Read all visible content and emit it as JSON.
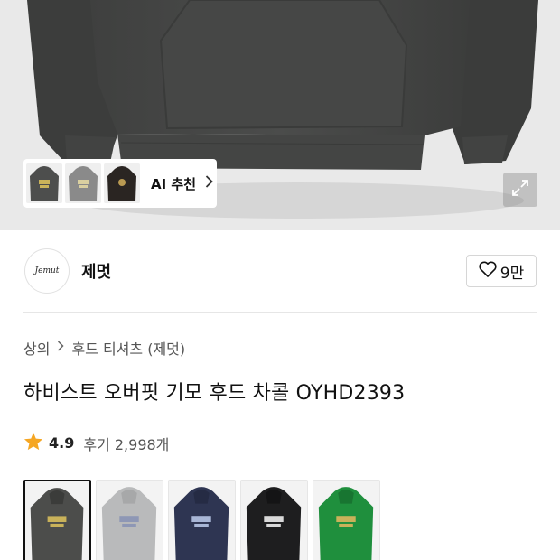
{
  "hero": {
    "garment_color": "#4a4b4a",
    "ai_recommend": {
      "label": "AI 추천",
      "thumbnails": [
        {
          "name": "thumb-dark-hoodie",
          "color": "#4d4e4d",
          "logo": "#c9b25a"
        },
        {
          "name": "thumb-gray-hoodie",
          "color": "#8a8a8a",
          "logo": "#d9cfa0"
        },
        {
          "name": "thumb-black-hoodie",
          "color": "#2a2522",
          "logo": "#b99a52"
        }
      ]
    },
    "expand_icon": "expand-icon"
  },
  "brand": {
    "logo_text": "Jemut",
    "name": "제멋",
    "likes": "9만"
  },
  "breadcrumb": {
    "category": "상의",
    "subcategory": "후드 티셔츠 (제멋)"
  },
  "product": {
    "title": "하비스트 오버핏 기모 후드 차콜 OYHD2393"
  },
  "rating": {
    "score": "4.9",
    "reviews": "후기 2,998개",
    "star_color": "#f5a623"
  },
  "swatches": [
    {
      "name": "charcoal",
      "color": "#4c4d4b",
      "selected": true
    },
    {
      "name": "light-gray",
      "color": "#b9babb",
      "selected": false
    },
    {
      "name": "navy",
      "color": "#2e3552",
      "selected": false
    },
    {
      "name": "black",
      "color": "#1e1e1f",
      "selected": false
    },
    {
      "name": "green",
      "color": "#1f8f3d",
      "selected": false
    }
  ]
}
